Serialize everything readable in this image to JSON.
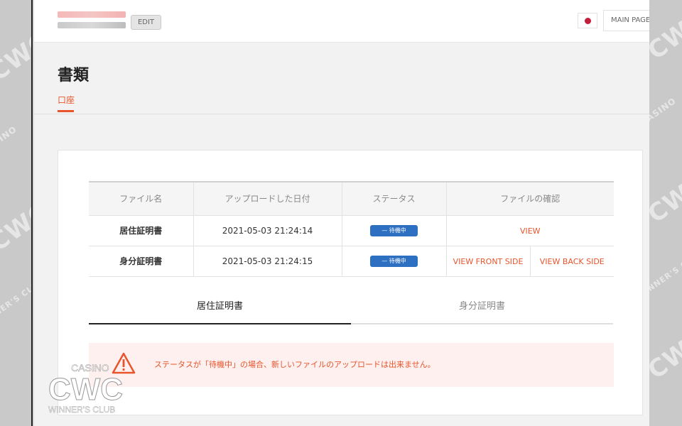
{
  "header": {
    "edit_label": "EDIT",
    "main_page_label": "MAIN PAGE"
  },
  "page": {
    "title": "書類",
    "tabs": [
      {
        "label": "口座",
        "active": true
      }
    ]
  },
  "table": {
    "headers": [
      "ファイル名",
      "アップロードした日付",
      "ステータス",
      "ファイルの確認"
    ],
    "rows": [
      {
        "name": "居住証明書",
        "date": "2021-05-03 21:24:14",
        "status": "待機中",
        "links": [
          "VIEW"
        ]
      },
      {
        "name": "身分証明書",
        "date": "2021-05-03 21:24:15",
        "status": "待機中",
        "links": [
          "VIEW FRONT SIDE",
          "VIEW BACK SIDE"
        ]
      }
    ]
  },
  "subtabs": [
    {
      "label": "居住証明書",
      "active": true
    },
    {
      "label": "身分証明書",
      "active": false
    }
  ],
  "alert": {
    "message": "ステータスが「待機中」の場合、新しいファイルのアップロードは出来ません。"
  },
  "watermark": {
    "top": "CASINO",
    "main": "CWC",
    "bottom": "WINNER'S CLUB",
    "side_texts": [
      "CASINO",
      "CWC",
      "WINNER'S CLUB"
    ]
  },
  "colors": {
    "accent": "#e8542b",
    "badge_blue": "#2d6fc0",
    "alert_bg": "#fdf0ee",
    "flag_red": "#c41e3a"
  },
  "icons": [
    "warning-icon",
    "japan-flag-icon"
  ]
}
